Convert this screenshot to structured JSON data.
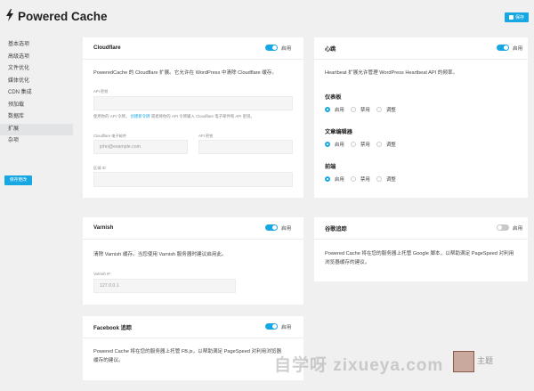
{
  "header": {
    "title": "Powered Cache",
    "save_label": "保存"
  },
  "sidebar": {
    "items": [
      {
        "label": "基本选项"
      },
      {
        "label": "高级选项"
      },
      {
        "label": "文件优化"
      },
      {
        "label": "媒体优化"
      },
      {
        "label": "CDN 集成"
      },
      {
        "label": "预加载"
      },
      {
        "label": "数据库"
      },
      {
        "label": "扩展"
      },
      {
        "label": "杂项"
      }
    ],
    "active_index": 7,
    "save_label": "保存更改"
  },
  "cloudflare": {
    "title": "Cloudflare",
    "toggle_label": "启用",
    "enabled": true,
    "description": "PoweredCache 的 Cloudflare 扩展。它允许在 WordPress 中清除 Cloudflare 缓存。",
    "api_token_label": "API 密钥",
    "api_token_hint_before": "使用你的 API 令牌。",
    "api_token_hint_link": "创建新令牌",
    "api_token_hint_after": "或者将你的 API 令牌输入 Cloudflare 电子邮件和 API 密钥。",
    "email_label": "Cloudflare 电子邮件",
    "email_placeholder": "john@example.com",
    "api_key_label": "API 密钥",
    "zone_label": "区域 ID"
  },
  "heartbeat": {
    "title": "心跳",
    "toggle_label": "启用",
    "enabled": true,
    "description": "Heartbeat 扩展允许管理 WordPress Heartbeat API 的频率。",
    "sections": [
      {
        "title": "仪表板",
        "options": [
          "启用",
          "禁用",
          "调整"
        ],
        "selected": 0
      },
      {
        "title": "文章编辑器",
        "options": [
          "启用",
          "禁用",
          "调整"
        ],
        "selected": 0
      },
      {
        "title": "前端",
        "options": [
          "启用",
          "禁用",
          "调整"
        ],
        "selected": 0
      }
    ]
  },
  "varnish": {
    "title": "Varnish",
    "toggle_label": "启用",
    "enabled": true,
    "description": "清除 Varnish 缓存。当您使用 Varnish 服务器时建议启用此。",
    "ip_label": "Varnish IP",
    "ip_value": "127.0.0.1"
  },
  "google_tracking": {
    "title": "谷歌追踪",
    "toggle_label": "启用",
    "enabled": false,
    "description_line1": "Powered Cache 将在您的服务器上托管 Google 脚本，以帮助满足 PageSpeed 对利用",
    "description_line2": "浏览器缓存的建议。"
  },
  "facebook_tracking": {
    "title": "Facebook 追踪",
    "toggle_label": "启用",
    "enabled": true,
    "description_line1": "Powered Cache 将在您的服务器上托管 FB.js，以帮助满足 PageSpeed 对利用浏览器",
    "description_line2": "缓存的建议。"
  },
  "watermark": {
    "text": "自学呀 zixueya.com",
    "stamp_text": "主题"
  },
  "colors": {
    "accent": "#17a8e3",
    "background": "#f0f0f1",
    "card": "#ffffff"
  }
}
